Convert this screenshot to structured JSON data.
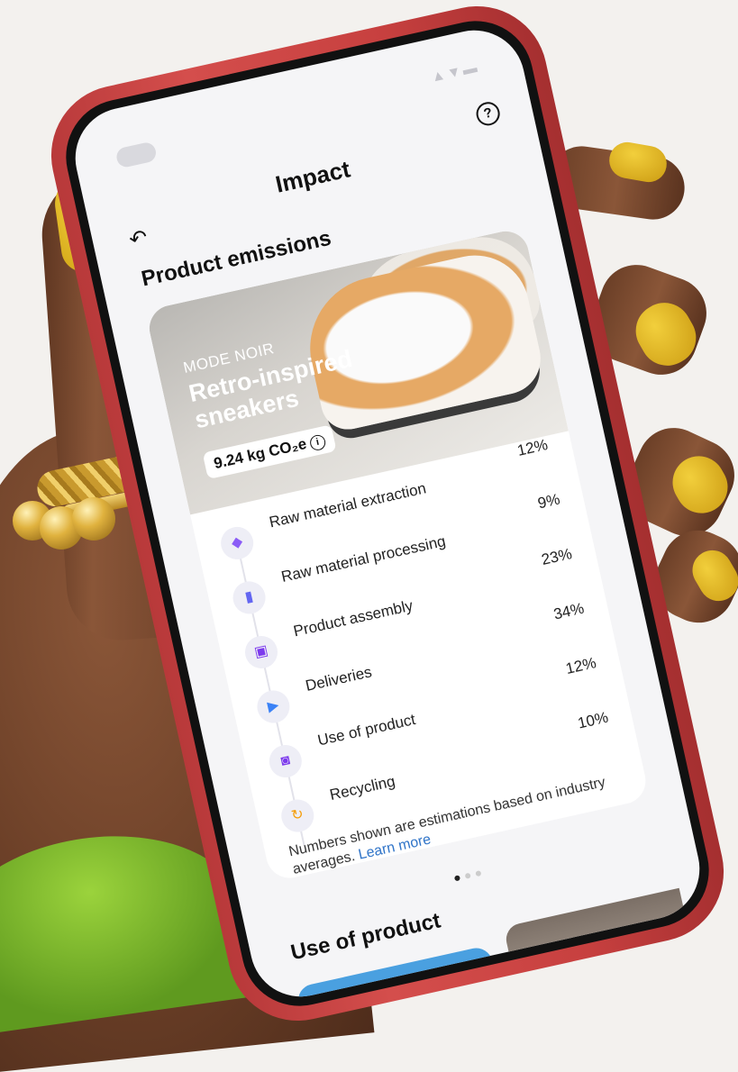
{
  "screen": {
    "title": "Impact",
    "section_title": "Product emissions",
    "product": {
      "brand": "MODE NOIR",
      "name": "Retro-inspired sneakers",
      "emissions": "9.24 kg CO₂e"
    },
    "breakdown": [
      {
        "label": "Raw material extraction",
        "percent": "12%",
        "icon": "gem-icon",
        "color": "#8b5cf6"
      },
      {
        "label": "Raw material processing",
        "percent": "9%",
        "icon": "book-icon",
        "color": "#6366f1"
      },
      {
        "label": "Product assembly",
        "percent": "23%",
        "icon": "box-icon",
        "color": "#7c3aed"
      },
      {
        "label": "Deliveries",
        "percent": "34%",
        "icon": "truck-icon",
        "color": "#3b82f6"
      },
      {
        "label": "Use of product",
        "percent": "12%",
        "icon": "washer-icon",
        "color": "#7c3aed"
      },
      {
        "label": "Recycling",
        "percent": "10%",
        "icon": "recycle-icon",
        "color": "#f59e0b"
      }
    ],
    "footnote": {
      "text": "Numbers shown are estimations based on industry averages.",
      "link": "Learn more"
    },
    "carousel": {
      "total": 3,
      "active": 0
    },
    "next_section_title": "Use of product"
  },
  "colors": {
    "case": "#c7403f",
    "nail": "#e8bf2b",
    "accent_link": "#2f74c8"
  }
}
